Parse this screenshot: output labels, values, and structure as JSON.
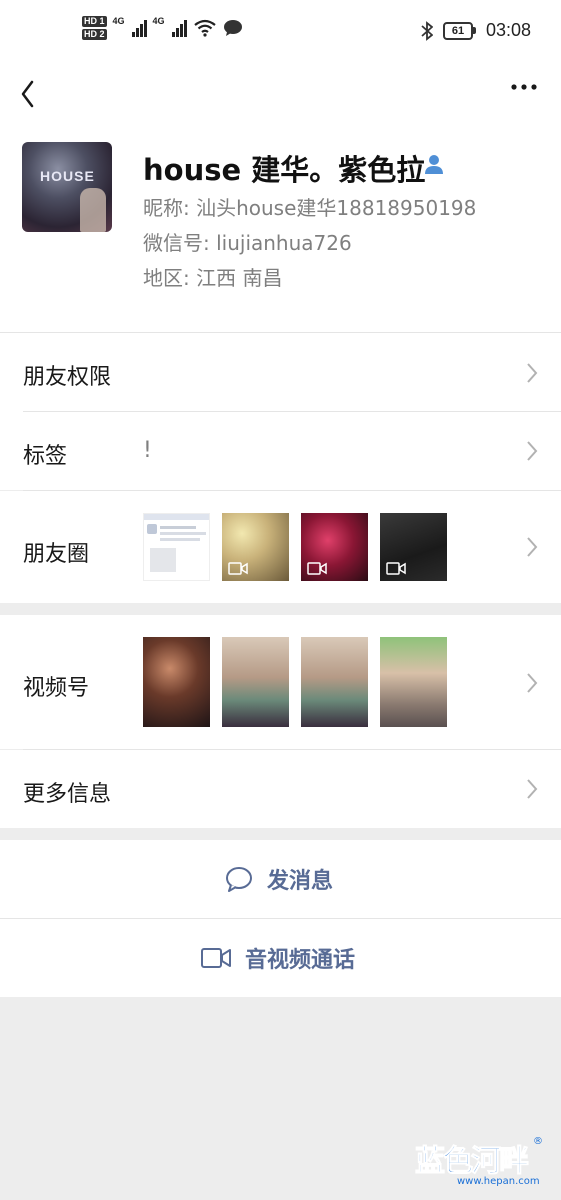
{
  "status_bar": {
    "hd1": "HD 1",
    "hd2": "HD 2",
    "net1": "4G",
    "net2": "4G",
    "battery": "61",
    "time": "03:08"
  },
  "profile": {
    "name": "house 建华。紫色拉",
    "nickname": "昵称:  汕头house建华18818950198",
    "wechat_id": "微信号:  liujianhua726",
    "region": "地区:  江西  南昌",
    "avatar_sign": "HOUSE"
  },
  "rows": {
    "permissions": "朋友权限",
    "tags_label": "标签",
    "tags_value": "!",
    "moments": "朋友圈",
    "channels": "视频号",
    "more_info": "更多信息"
  },
  "actions": {
    "message": "发消息",
    "call": "音视频通话"
  },
  "watermark": {
    "text": "蓝色河畔",
    "url": "www.hepan.com",
    "reg": "®"
  },
  "colors": {
    "link_blue": "#586b95",
    "background": "#ededed",
    "watermark_blue": "#1a6fd6"
  }
}
